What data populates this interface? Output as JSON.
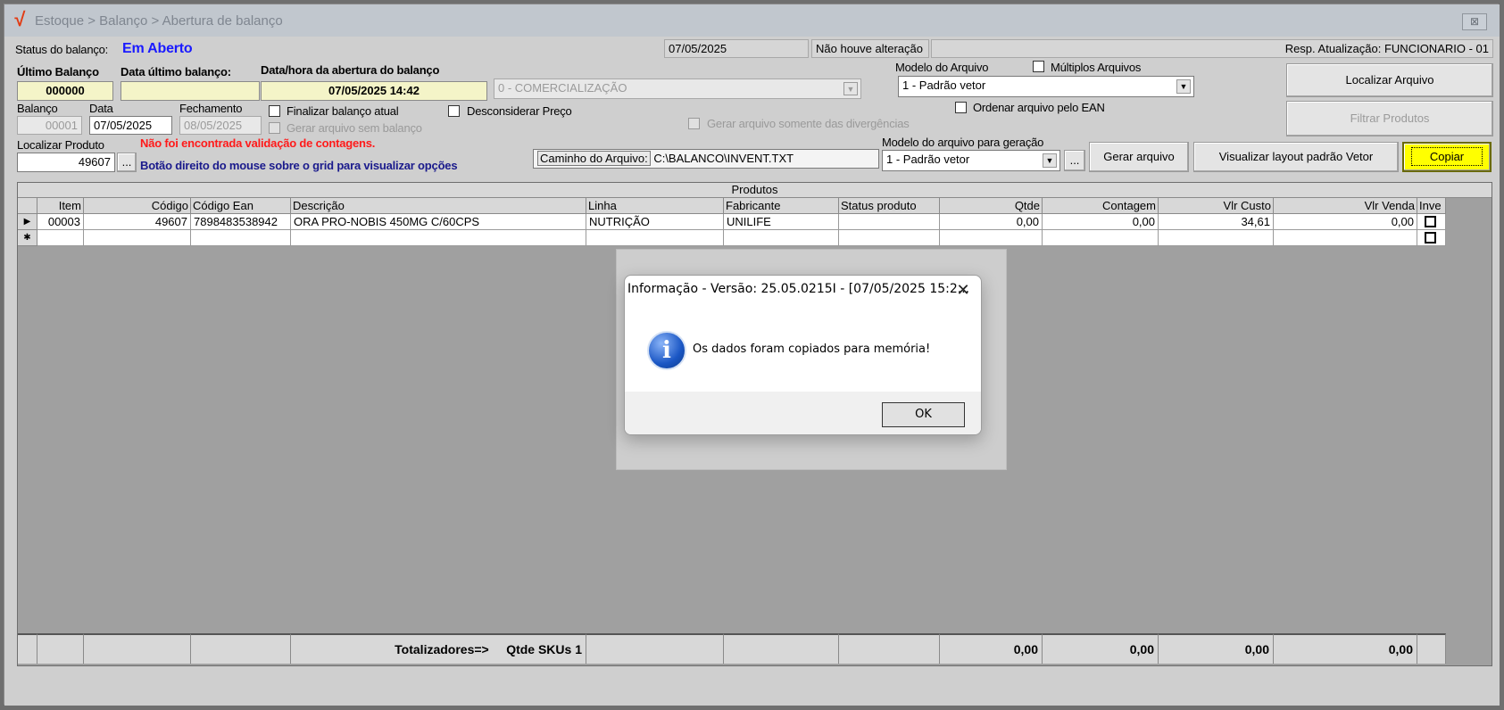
{
  "window": {
    "title": "Estoque > Balanço > Abertura de balanço",
    "logo": "√",
    "close_glyph": "⊠"
  },
  "status": {
    "label": "Status do balanço:",
    "value": "Em Aberto",
    "date": "07/05/2025",
    "change_text": "Não houve alteração",
    "resp": "Resp. Atualização: FUNCIONARIO - 01"
  },
  "fields": {
    "ultimo_balanco_label": "Último Balanço",
    "ultimo_balanco_value": "000000",
    "data_ultimo_label": "Data último balanço:",
    "data_ultimo_value": "",
    "abertura_label": "Data/hora da abertura do balanço",
    "abertura_value": "07/05/2025 14:42",
    "tipo_value": "0 - COMERCIALIZAÇÃO",
    "modelo_arquivo_label": "Modelo do Arquivo",
    "modelo_arquivo_value": "1 - Padrão vetor",
    "multiplos_label": "Múltiplos Arquivos",
    "balanco_label": "Balanço",
    "balanco_value": "00001",
    "data_label": "Data",
    "data_value": "07/05/2025",
    "fechamento_label": "Fechamento",
    "fechamento_value": "08/05/2025",
    "finalizar_label": "Finalizar balanço atual",
    "gerar_sem_label": "Gerar arquivo sem balanço",
    "desconsiderar_label": "Desconsiderar Preço",
    "gerar_div_label": "Gerar arquivo somente das divergências",
    "ordenar_ean_label": "Ordenar arquivo pelo EAN",
    "localizar_label": "Localizar Produto",
    "localizar_value": "49607",
    "ellipsis": "...",
    "validacao_msg": "Não foi encontrada validação de contagens.",
    "hint_msg": "Botão direito do mouse sobre o grid para visualizar opções",
    "caminho_label": "Caminho do Arquivo:",
    "caminho_value": "C:\\BALANCO\\INVENT.TXT",
    "modelo_geracao_label": "Modelo do arquivo para geração",
    "modelo_geracao_value": "1 - Padrão vetor"
  },
  "buttons": {
    "localizar_arquivo": "Localizar Arquivo",
    "filtrar_produtos": "Filtrar Produtos",
    "gerar_arquivo": "Gerar arquivo",
    "visualizar_layout": "Visualizar layout padrão Vetor",
    "copiar": "Copiar"
  },
  "grid": {
    "caption": "Produtos",
    "columns": [
      "Item",
      "Código",
      "Código Ean",
      "Descrição",
      "Linha",
      "Fabricante",
      "Status produto",
      "Qtde",
      "Contagem",
      "Vlr Custo",
      "Vlr Venda",
      "Inve"
    ],
    "row": {
      "item": "00003",
      "codigo": "49607",
      "ean": "7898483538942",
      "descricao": "ORA PRO-NOBIS 450MG C/60CPS",
      "linha": "NUTRIÇÃO",
      "fabricante": "UNILIFE",
      "status": "",
      "qtde": "0,00",
      "contagem": "0,00",
      "custo": "34,61",
      "venda": "0,00"
    },
    "totals": {
      "label": "Totalizadores=>",
      "skus": "Qtde SKUs 1",
      "qtde": "0,00",
      "contagem": "0,00",
      "custo": "0,00",
      "venda": "0,00"
    }
  },
  "dialog": {
    "title": "Informação - Versão: 25.05.0215I - [07/05/2025 15:2...",
    "message": "Os dados foram copiados para memória!",
    "ok": "OK",
    "close_glyph": "✕",
    "icon": "info-icon",
    "icon_glyph": "i"
  },
  "colors": {
    "status_value": "#1a1aff",
    "warning": "#ff1a1a",
    "hint": "#1a1a8c",
    "copy_highlight": "#ffff00"
  }
}
